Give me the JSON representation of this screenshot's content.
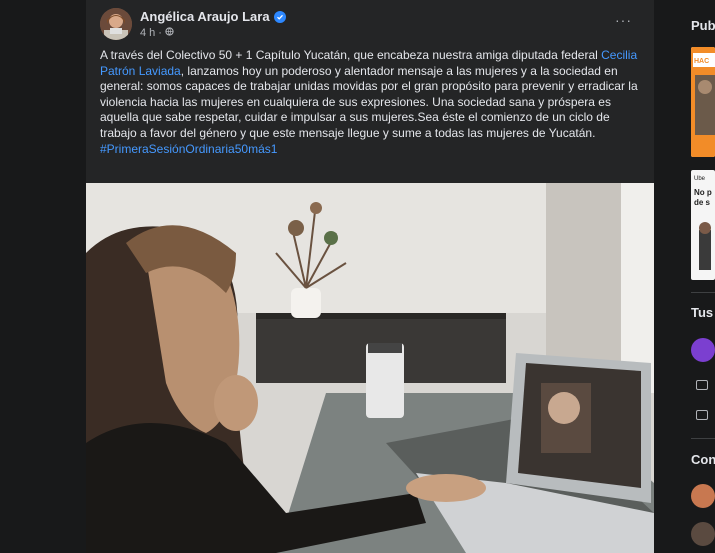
{
  "post": {
    "author": "Angélica Araujo Lara",
    "time": "4 h",
    "more_label": "···",
    "body": {
      "intro": "A través del Colectivo 50 + 1 Capítulo Yucatán, que encabeza nuestra amiga diputada federal ",
      "mention": "Cecilia Patrón Laviada",
      "rest": ", lanzamos hoy un poderoso y alentador mensaje a las mujeres y a la sociedad en general: somos capaces de trabajar unidas movidas por el gran propósito para prevenir y erradicar la violencia hacia las mujeres en cualquiera de sus expresiones. Una sociedad sana y próspera es aquella que sabe respetar, cuidar e impulsar a sus mujeres.Sea éste el comienzo de un ciclo de trabajo a favor del género y que este mensaje llegue y sume a todas las mujeres de Yucatán.",
      "hashtag": "#PrimeraSesiónOrdinaria50más1"
    },
    "icons": {
      "verified": "verified-badge-icon",
      "privacy": "globe-icon",
      "more": "more-options-icon"
    }
  },
  "sidebar": {
    "sponsored_title": "Pub",
    "ad1_label": "HAC",
    "ad2_lines": [
      "Ube",
      "No p",
      "de s"
    ],
    "birthdays_title": "Tus",
    "contacts_title": "Con"
  },
  "colors": {
    "background": "#18191a",
    "card": "#242526",
    "text_primary": "#e4e6eb",
    "text_secondary": "#b0b3b8",
    "link": "#4599ff",
    "verified": "#2d88ff"
  }
}
